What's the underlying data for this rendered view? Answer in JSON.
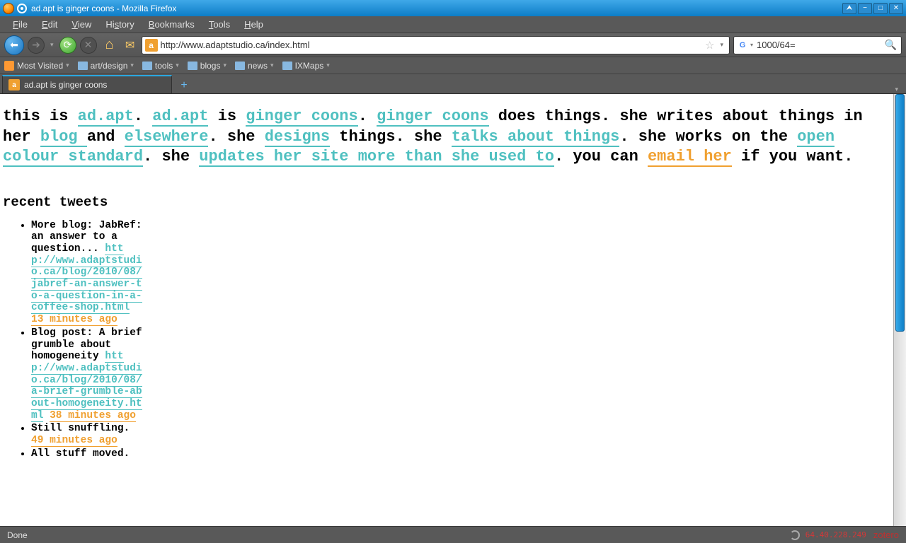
{
  "window": {
    "title": "ad.apt is ginger coons - Mozilla Firefox"
  },
  "menus": [
    "File",
    "Edit",
    "View",
    "History",
    "Bookmarks",
    "Tools",
    "Help"
  ],
  "url": "http://www.adaptstudio.ca/index.html",
  "search": {
    "value": "1000/64="
  },
  "bookmarks": [
    {
      "label": "Most Visited",
      "kind": "mv"
    },
    {
      "label": "art/design",
      "kind": "folder"
    },
    {
      "label": "tools",
      "kind": "folder"
    },
    {
      "label": "blogs",
      "kind": "folder"
    },
    {
      "label": "news",
      "kind": "folder"
    },
    {
      "label": "IXMaps",
      "kind": "folder"
    }
  ],
  "tab": {
    "title": "ad.apt is ginger coons"
  },
  "page": {
    "intro": {
      "t0": "this is ",
      "l0": "ad.apt",
      "t1": ". ",
      "l1": "ad.apt",
      "t2": " is ",
      "l2": "ginger coons",
      "t3": ". ",
      "l3": "ginger coons",
      "t4": " does things. she writes about things in her ",
      "l4": "blog ",
      "t5": "and ",
      "l5": "elsewhere",
      "t6": ". she ",
      "l6": "designs",
      "t7": " things. she ",
      "l7": "talks about things",
      "t8": ". she works on the ",
      "l8": "open colour standard",
      "t9": ". she ",
      "l9": "updates her site more than she used to",
      "t10": ". you can ",
      "l10": "email her",
      "t11": " if you want."
    },
    "tweets_heading": "recent tweets",
    "tweets": [
      {
        "text": "More blog: JabRef: an answer to a question... ",
        "link": "http://www.adaptstudio.ca/blog/2010/08/jabref-an-answer-to-a-question-in-a-coffee-shop.html",
        "time": "13 minutes ago"
      },
      {
        "text": "Blog post: A brief grumble about homogeneity ",
        "link": "http://www.adaptstudio.ca/blog/2010/08/a-brief-grumble-about-homogeneity.html",
        "time": "38 minutes ago"
      },
      {
        "text": "Still snuffling.",
        "link": "",
        "time": "49 minutes ago"
      },
      {
        "text": "All stuff moved.",
        "link": "",
        "time": ""
      }
    ]
  },
  "status": {
    "msg": "Done",
    "ip": "64.40.228.249",
    "zotero": "zotero"
  }
}
